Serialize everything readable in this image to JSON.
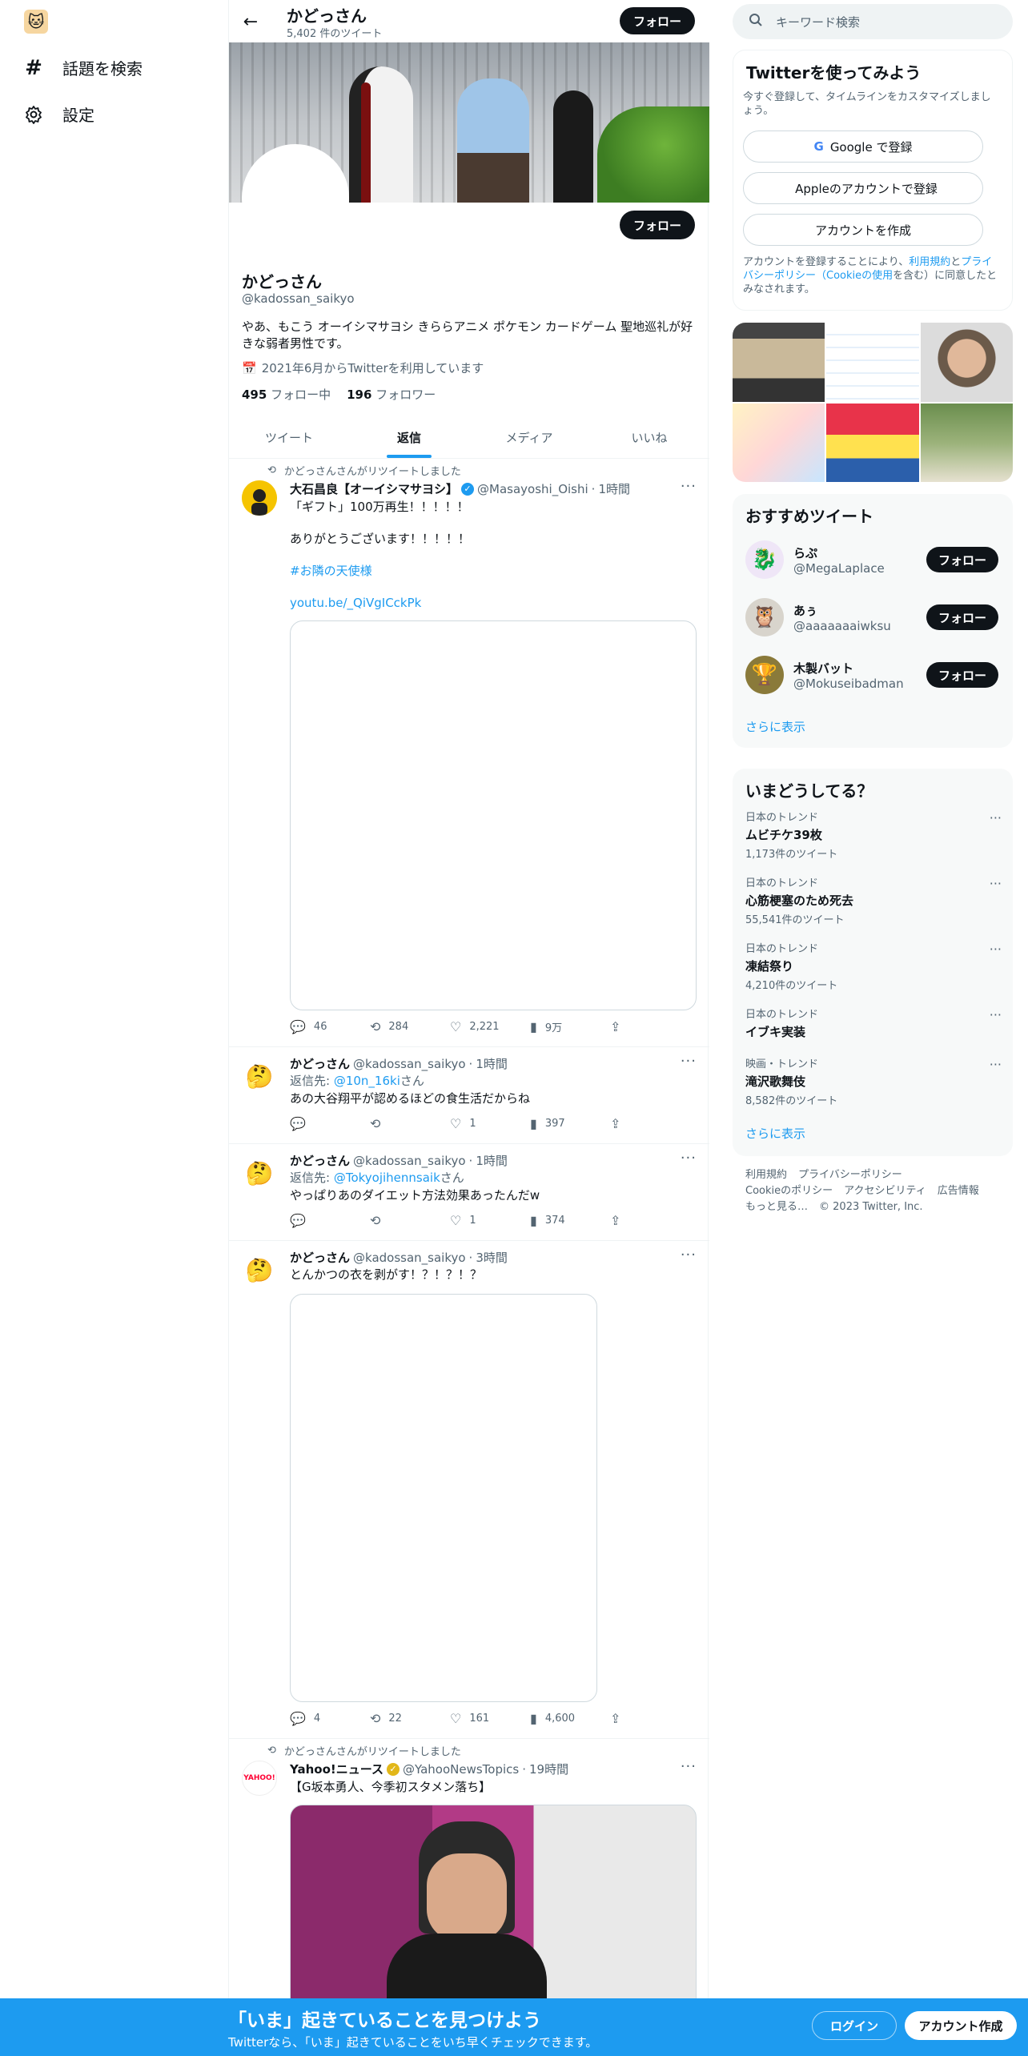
{
  "nav": {
    "items": [
      {
        "label": "話題を検索",
        "icon": "hashtag-icon"
      },
      {
        "label": "設定",
        "icon": "gear-icon"
      }
    ]
  },
  "header": {
    "title": "かどっさん",
    "subtitle": "5,402 件のツイート",
    "follow_label": "フォロー"
  },
  "profile": {
    "name": "かどっさん",
    "handle": "@kadossan_saikyo",
    "bio": "やあ、もこう オーイシマサヨシ きららアニメ ポケモン カードゲーム 聖地巡礼が好きな弱者男性です。",
    "joined": "2021年6月からTwitterを利用しています",
    "following_count": "495",
    "following_label": "フォロー中",
    "followers_count": "196",
    "followers_label": "フォロワー",
    "follow_label": "フォロー"
  },
  "tabs": [
    {
      "label": "ツイート",
      "active": false
    },
    {
      "label": "返信",
      "active": true
    },
    {
      "label": "メディア",
      "active": false
    },
    {
      "label": "いいね",
      "active": false
    }
  ],
  "tweets": [
    {
      "retweet_line": "かどっさんさんがリツイートしました",
      "name": "大石昌良【オーイシマサヨシ】",
      "handle": "@Masayoshi_Oishi",
      "time": "1時間",
      "lines": [
        "「ギフト」100万再生！！！！！",
        "ありがとうございます！！！！！",
        "#お隣の天使様",
        "youtu.be/_QiVgICckPk"
      ],
      "replies": "46",
      "retweets": "284",
      "likes": "2,221",
      "views": "9万"
    },
    {
      "name": "かどっさん",
      "handle": "@kadossan_saikyo",
      "time": "1時間",
      "reply_to_prefix": "返信先: ",
      "reply_to": "@10n_16ki",
      "reply_to_suffix": "さん",
      "text": "あの大谷翔平が認めるほどの食生活だからね",
      "replies": "",
      "retweets": "",
      "likes": "1",
      "views": "397"
    },
    {
      "name": "かどっさん",
      "handle": "@kadossan_saikyo",
      "time": "1時間",
      "reply_to_prefix": "返信先: ",
      "reply_to": "@Tokyojihennsaik",
      "reply_to_suffix": "さん",
      "text": "やっぱりあのダイエット方法効果あったんだw",
      "replies": "",
      "retweets": "",
      "likes": "1",
      "views": "374"
    },
    {
      "name": "かどっさん",
      "handle": "@kadossan_saikyo",
      "time": "3時間",
      "text": "とんかつの衣を剥がす！？！？！？",
      "replies": "4",
      "retweets": "22",
      "likes": "161",
      "views": "4,600"
    },
    {
      "retweet_line": "かどっさんさんがリツイートしました",
      "name": "Yahoo!ニュース",
      "handle": "@YahooNewsTopics",
      "time": "19時間",
      "text": "【G坂本勇人、今季初スタメン落ち】",
      "avatar_text": "YAHOO!"
    }
  ],
  "right": {
    "search_placeholder": "キーワード検索",
    "signup": {
      "title": "Twitterを使ってみよう",
      "subtitle": "今すぐ登録して、タイムラインをカスタマイズしましょう。",
      "google": "Google で登録",
      "apple": "Appleのアカウントで登録",
      "create": "アカウントを作成",
      "legal_1": "アカウントを登録することにより、",
      "legal_link1": "利用規約",
      "legal_2": "と",
      "legal_link2": "プライバシーポリシー（Cookieの使用",
      "legal_3": "を含む）に同意したとみなされます。"
    },
    "recommend": {
      "title": "おすすめツイート",
      "users": [
        {
          "name": "らぷ",
          "handle": "@MegaLaplace"
        },
        {
          "name": "あぅ",
          "handle": "@aaaaaaaiwksu"
        },
        {
          "name": "木製バット",
          "handle": "@Mokuseibadman"
        }
      ],
      "follow_label": "フォロー",
      "more": "さらに表示"
    },
    "trends": {
      "title": "いまどうしてる？",
      "items": [
        {
          "category": "日本のトレンド",
          "title": "ムビチケ39枚",
          "count": "1,173件のツイート"
        },
        {
          "category": "日本のトレンド",
          "title": "心筋梗塞のため死去",
          "count": "55,541件のツイート"
        },
        {
          "category": "日本のトレンド",
          "title": "凍結祭り",
          "count": "4,210件のツイート"
        },
        {
          "category": "日本のトレンド",
          "title": "イブキ実装",
          "count": ""
        },
        {
          "category": "映画・トレンド",
          "title": "滝沢歌舞伎",
          "count": "8,582件のツイート"
        }
      ],
      "more": "さらに表示"
    },
    "footer": [
      "利用規約",
      "プライバシーポリシー",
      "Cookieのポリシー",
      "アクセシビリティ",
      "広告情報",
      "もっと見る…",
      "© 2023 Twitter, Inc."
    ]
  },
  "bottom": {
    "title": "「いま」起きていることを見つけよう",
    "subtitle": "Twitterなら、「いま」起きていることをいち早くチェックできます。",
    "login": "ログイン",
    "signup": "アカウント作成"
  },
  "colors": {
    "accent": "#1d9bf0",
    "dark": "#0f1419",
    "muted": "#536471"
  }
}
